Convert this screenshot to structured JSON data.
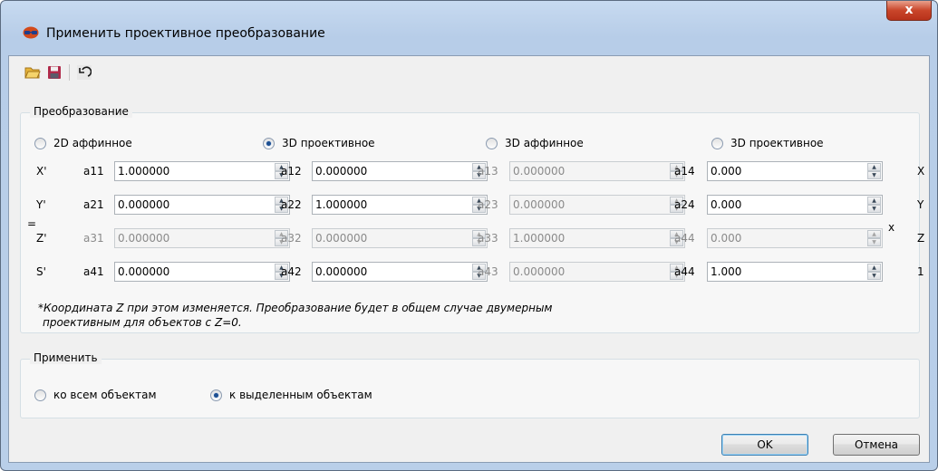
{
  "window": {
    "title": "Применить проективное преобразование",
    "close_label": "x"
  },
  "toolbar": {
    "icons": [
      "open-folder-icon",
      "save-icon",
      "undo-icon"
    ]
  },
  "transform_group": {
    "title": "Преобразование",
    "modes": [
      {
        "label": "2D аффинное",
        "checked": false
      },
      {
        "label": "3D проективное",
        "checked": true
      },
      {
        "label": "3D аффинное",
        "checked": false
      },
      {
        "label": "3D проективное",
        "checked": false
      }
    ],
    "left_vars": [
      "X'",
      "Y'",
      "Z'",
      "S'"
    ],
    "right_vars": [
      "X",
      "Y",
      "Z",
      "1"
    ],
    "equals": "=",
    "times": "x",
    "rows": [
      [
        {
          "name": "a11",
          "value": "1.000000",
          "disabled": false
        },
        {
          "name": "a12",
          "value": "0.000000",
          "disabled": false
        },
        {
          "name": "a13",
          "value": "0.000000",
          "disabled": true
        },
        {
          "name": "a14",
          "value": "0.000",
          "disabled": false
        }
      ],
      [
        {
          "name": "a21",
          "value": "0.000000",
          "disabled": false
        },
        {
          "name": "a22",
          "value": "1.000000",
          "disabled": false
        },
        {
          "name": "a23",
          "value": "0.000000",
          "disabled": true
        },
        {
          "name": "a24",
          "value": "0.000",
          "disabled": false
        }
      ],
      [
        {
          "name": "a31",
          "value": "0.000000",
          "disabled": true
        },
        {
          "name": "a32",
          "value": "0.000000",
          "disabled": true
        },
        {
          "name": "a33",
          "value": "1.000000",
          "disabled": true
        },
        {
          "name": "a44",
          "value": "0.000",
          "disabled": true
        }
      ],
      [
        {
          "name": "a41",
          "value": "0.000000",
          "disabled": false
        },
        {
          "name": "a42",
          "value": "0.000000",
          "disabled": false
        },
        {
          "name": "a43",
          "value": "0.000000",
          "disabled": true
        },
        {
          "name": "a44",
          "value": "1.000",
          "disabled": false
        }
      ]
    ],
    "note_line1": "*Координата Z при этом изменяется. Преобразование будет в общем случае двумерным",
    "note_line2": "проективным для объектов с Z=0."
  },
  "apply_group": {
    "title": "Применить",
    "options": [
      {
        "label": "ко всем объектам",
        "checked": false
      },
      {
        "label": "к выделенным объектам",
        "checked": true
      }
    ]
  },
  "buttons": {
    "ok": "OK",
    "cancel": "Отмена"
  }
}
